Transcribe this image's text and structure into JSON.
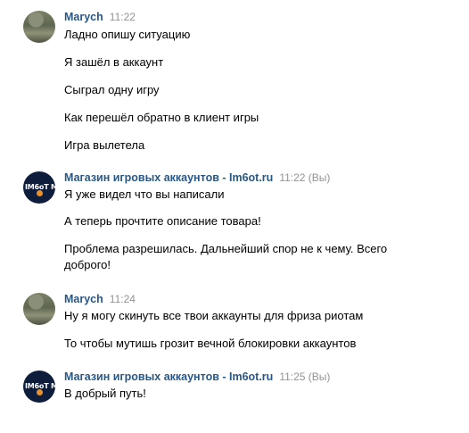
{
  "messages": [
    {
      "author": "Marych",
      "time": "11:22",
      "lines": [
        "Ладно опишу ситуацию",
        "Я зашёл в аккаунт",
        "Сыграл одну игру",
        "Как перешёл обратно в клиент игры",
        "Игра вылетела"
      ]
    },
    {
      "author": "Магазин игровых аккаунтов - Im6ot.ru",
      "time": "11:22 (Вы)",
      "avatar_text": "IM6oT M",
      "lines": [
        "Я уже видел что вы написали",
        "А теперь прочтите описание товара!",
        "Проблема разрешилась. Дальнейший спор не к чему. Всего доброго!"
      ]
    },
    {
      "author": "Marych",
      "time": "11:24",
      "lines": [
        "Ну я могу скинуть все твои аккаунты для фриза риотам",
        "То чтобы мутишь грозит вечной блокировки аккаунтов"
      ]
    },
    {
      "author": "Магазин игровых аккаунтов - Im6ot.ru",
      "time": "11:25 (Вы)",
      "avatar_text": "IM6oT M",
      "lines": [
        "В добрый путь!"
      ]
    }
  ],
  "colors": {
    "author": "#2a5885",
    "time": "#939393",
    "text": "#000000",
    "shop_avatar_bg": "#0f1d3d",
    "shop_avatar_accent": "#e8912d"
  }
}
